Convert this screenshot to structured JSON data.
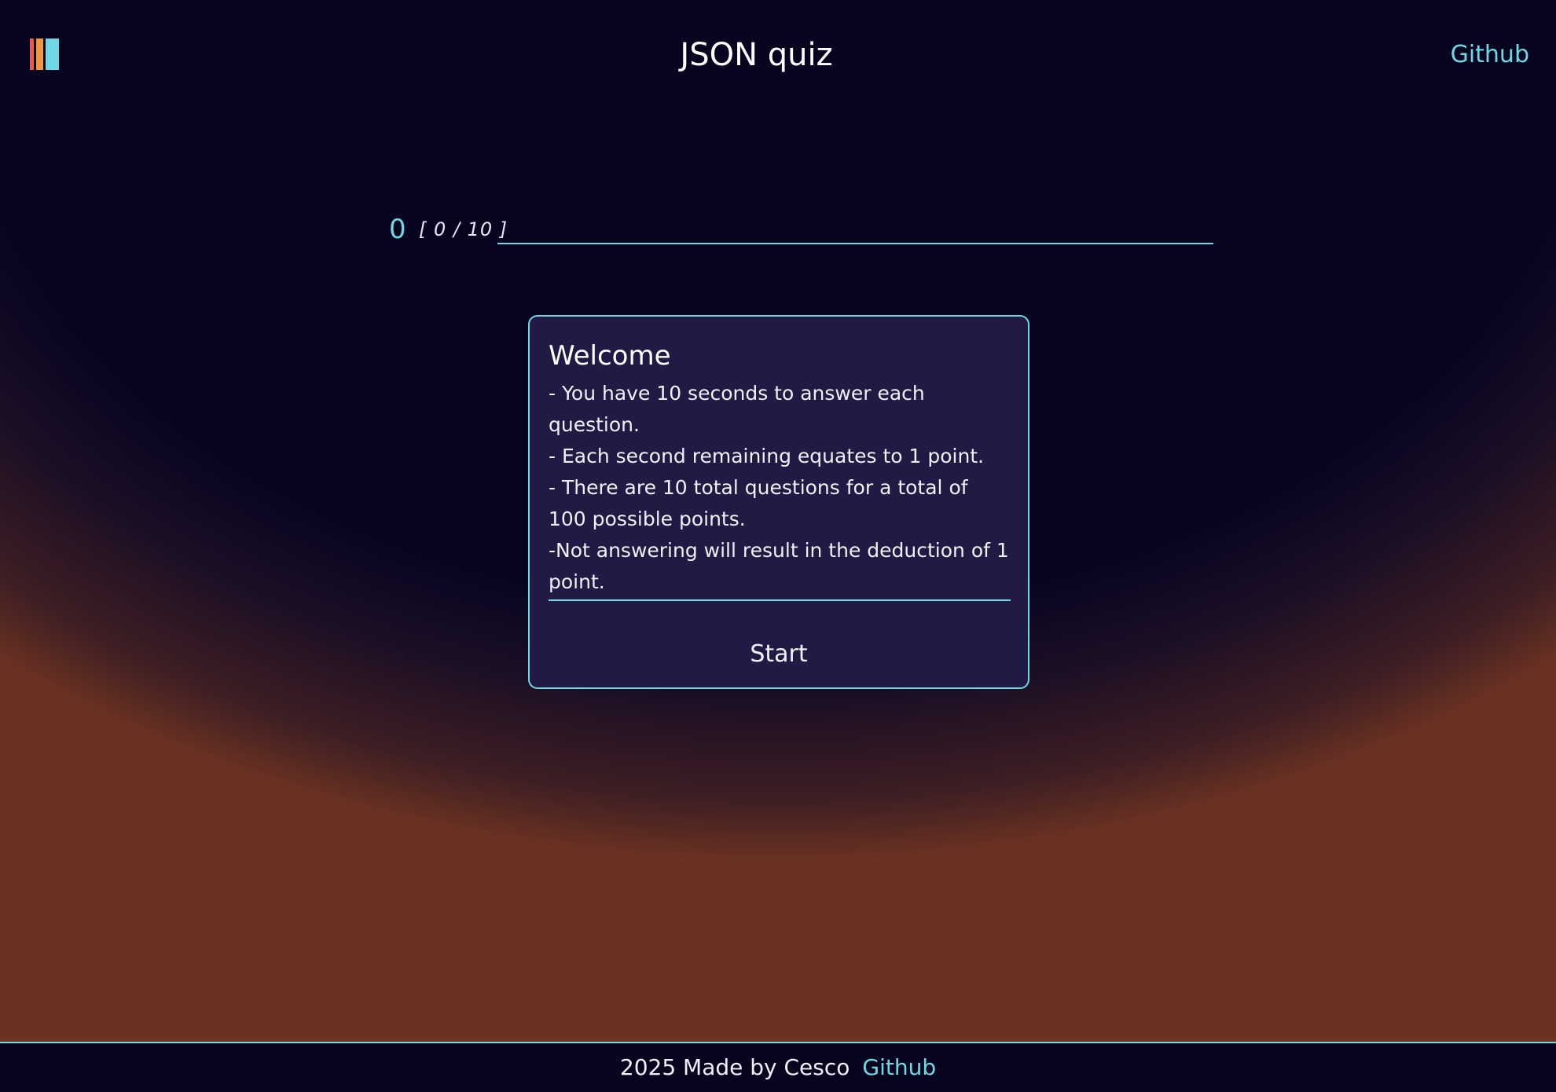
{
  "colors": {
    "accent": "#6fd8e2",
    "logo_bar_a": "#e65a4e",
    "logo_bar_b": "#f0963c",
    "logo_bar_c": "#6fd8e2",
    "card_background": "#221944",
    "page_background": "#070420",
    "glow": "#6b3222"
  },
  "header": {
    "logo_icon": "striped-bars-logo",
    "title": "JSON quiz",
    "github_link": "Github"
  },
  "progress": {
    "score": "0",
    "count": "[ 0 / 10 ]",
    "fraction_complete": 0
  },
  "card": {
    "title": "Welcome",
    "rules": [
      "- You have 10 seconds to answer each question.",
      "- Each second remaining equates to 1 point.",
      "- There are 10 total questions for a total of 100 possible points.",
      "-Not answering will result in the deduction of 1 point."
    ],
    "start_label": "Start"
  },
  "footer": {
    "text": "2025 Made by Cesco",
    "github_link": "Github"
  }
}
